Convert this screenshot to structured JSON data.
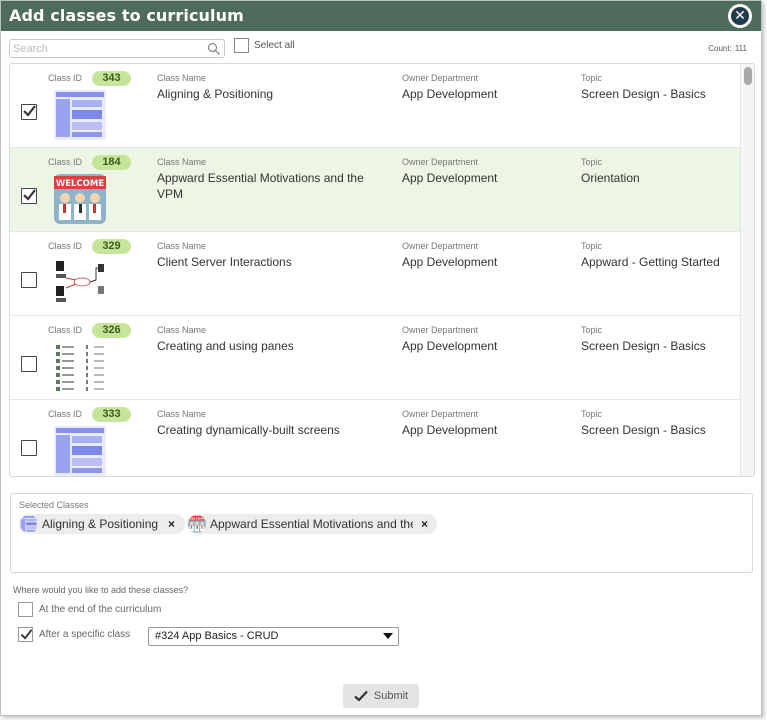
{
  "dialog": {
    "title": "Add classes to curriculum",
    "close_icon": "close-icon"
  },
  "toolbar": {
    "search_placeholder": "Search",
    "search_value": "",
    "select_all_label": "Select all",
    "count_label": "Count:",
    "count_value": "111"
  },
  "field_labels": {
    "class_id": "Class ID",
    "class_name": "Class Name",
    "owner": "Owner Department",
    "topic": "Topic"
  },
  "classes": [
    {
      "id": "343",
      "name": "Aligning & Positioning",
      "owner": "App Development",
      "topic": "Screen Design - Basics",
      "checked": true,
      "highlight": false,
      "thumb": "ui-blue"
    },
    {
      "id": "184",
      "name": "Appward Essential Motivations and the VPM",
      "owner": "App Development",
      "topic": "Orientation",
      "checked": true,
      "highlight": true,
      "thumb": "welcome"
    },
    {
      "id": "329",
      "name": "Client Server Interactions",
      "owner": "App Development",
      "topic": "Appward - Getting Started",
      "checked": false,
      "highlight": false,
      "thumb": "diagram"
    },
    {
      "id": "326",
      "name": "Creating and using panes",
      "owner": "App Development",
      "topic": "Screen Design - Basics",
      "checked": false,
      "highlight": false,
      "thumb": "list"
    },
    {
      "id": "333",
      "name": "Creating dynamically-built screens",
      "owner": "App Development",
      "topic": "Screen Design - Basics",
      "checked": false,
      "highlight": false,
      "thumb": "ui-blue"
    }
  ],
  "selected": {
    "header": "Selected Classes",
    "chips": [
      {
        "label": "Aligning & Positioning",
        "thumb": "ui-blue"
      },
      {
        "label": "Appward Essential Motivations and the VPM",
        "thumb": "welcome"
      }
    ]
  },
  "placement": {
    "question": "Where would you like to add these classes?",
    "options": [
      {
        "label": "At the end of the curriculum",
        "checked": false
      },
      {
        "label": "After a specific class",
        "checked": true
      }
    ],
    "dropdown_value": "#324 App Basics - CRUD"
  },
  "submit": {
    "label": "Submit"
  },
  "colors": {
    "titlebar": "#4f6b5b",
    "id_pill": "#c6e59a",
    "selected_row": "#edf6e4"
  }
}
